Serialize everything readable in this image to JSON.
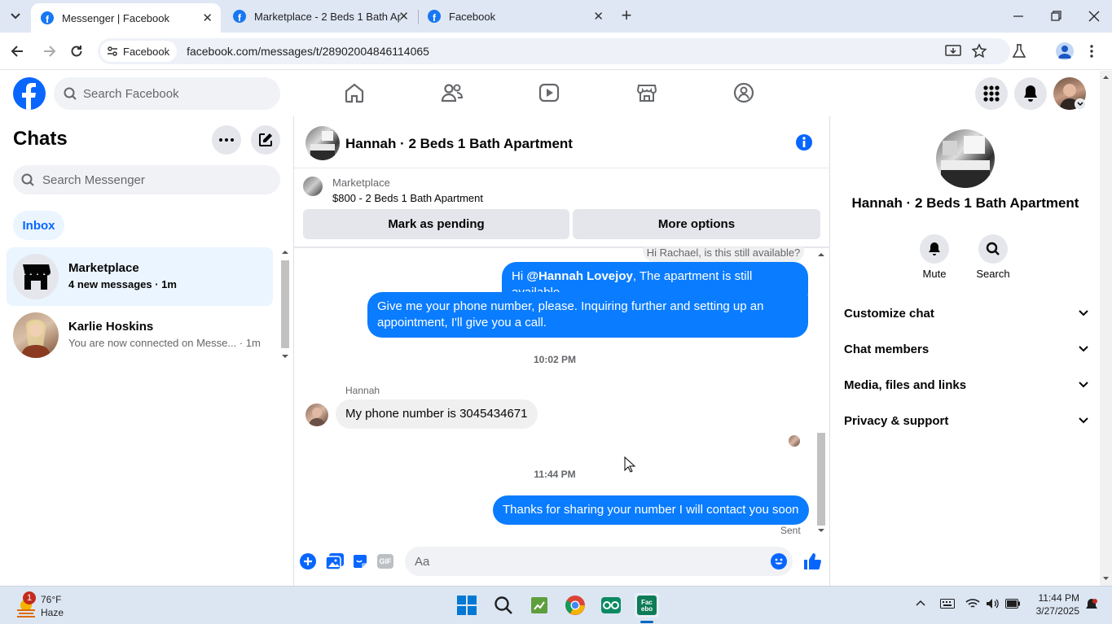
{
  "browser": {
    "tabs": [
      {
        "title": "Messenger | Facebook",
        "active": true
      },
      {
        "title": "Marketplace - 2 Beds 1 Bath Ap",
        "active": false
      },
      {
        "title": "Facebook",
        "active": false
      }
    ],
    "site_chip": "Facebook",
    "url": "facebook.com/messages/t/28902004846114065"
  },
  "fb_header": {
    "search_placeholder": "Search Facebook"
  },
  "chats_panel": {
    "title": "Chats",
    "search_placeholder": "Search Messenger",
    "inbox_label": "Inbox",
    "threads": [
      {
        "name": "Marketplace",
        "preview": "4 new messages · 1m",
        "unread": true
      },
      {
        "name": "Karlie Hoskins",
        "preview": "You are now connected on Messe... · 1m",
        "unread": false
      }
    ]
  },
  "conversation": {
    "title": "Hannah · 2 Beds 1 Bath Apartment",
    "listing": {
      "source": "Marketplace",
      "title": "$800 - 2 Beds 1 Bath Apartment"
    },
    "actions": {
      "pending": "Mark as pending",
      "more": "More options"
    },
    "reply_preview": "Hi Rachael, is this still available?",
    "messages": [
      {
        "mention": "@Hannah Lovejoy",
        "text_before": "Hi ",
        "text_after": ", The apartment is still available."
      },
      {
        "text": "Give me your phone number, please. Inquiring further and setting up an appointment, I'll give you a call."
      }
    ],
    "time_1": "10:02 PM",
    "sender_name": "Hannah",
    "incoming_text": "My phone number is 3045434671",
    "time_2": "11:44 PM",
    "last_sent": "Thanks for sharing your number I will contact you soon",
    "sent_status": "Sent",
    "composer_placeholder": "Aa"
  },
  "details_panel": {
    "title": "Hannah · 2 Beds 1 Bath Apartment",
    "mute_label": "Mute",
    "search_label": "Search",
    "sections": [
      "Customize chat",
      "Chat members",
      "Media, files and links",
      "Privacy & support"
    ]
  },
  "taskbar": {
    "weather_temp": "76°F",
    "weather_desc": "Haze",
    "weather_badge": "1",
    "time": "11:44 PM",
    "date": "3/27/2025"
  },
  "colors": {
    "fb_blue": "#0866ff",
    "bubble_blue": "#0a7cff",
    "tab_bg": "#dfe7f5"
  }
}
